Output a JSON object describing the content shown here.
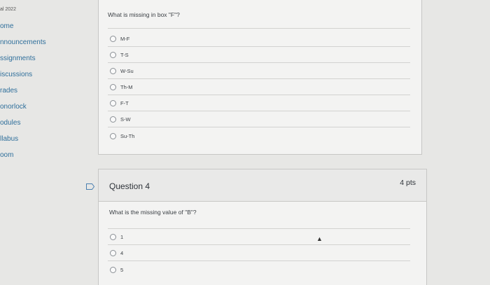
{
  "sidebar": {
    "term": "al 2022",
    "items": [
      {
        "label": "ome"
      },
      {
        "label": "nnouncements"
      },
      {
        "label": "ssignments"
      },
      {
        "label": "iscussions"
      },
      {
        "label": "rades"
      },
      {
        "label": "onorlock"
      },
      {
        "label": "odules"
      },
      {
        "label": "llabus"
      },
      {
        "label": "oom"
      }
    ]
  },
  "q3": {
    "text": "What is missing in box \"F\"?",
    "answers": [
      "M-F",
      "T-S",
      "W-Su",
      "Th-M",
      "F-T",
      "S-W",
      "Su-Th"
    ]
  },
  "q4": {
    "title": "Question 4",
    "points": "4 pts",
    "text": "What is the missing value of \"B\"?",
    "answers": [
      "1",
      "4",
      "5"
    ]
  }
}
